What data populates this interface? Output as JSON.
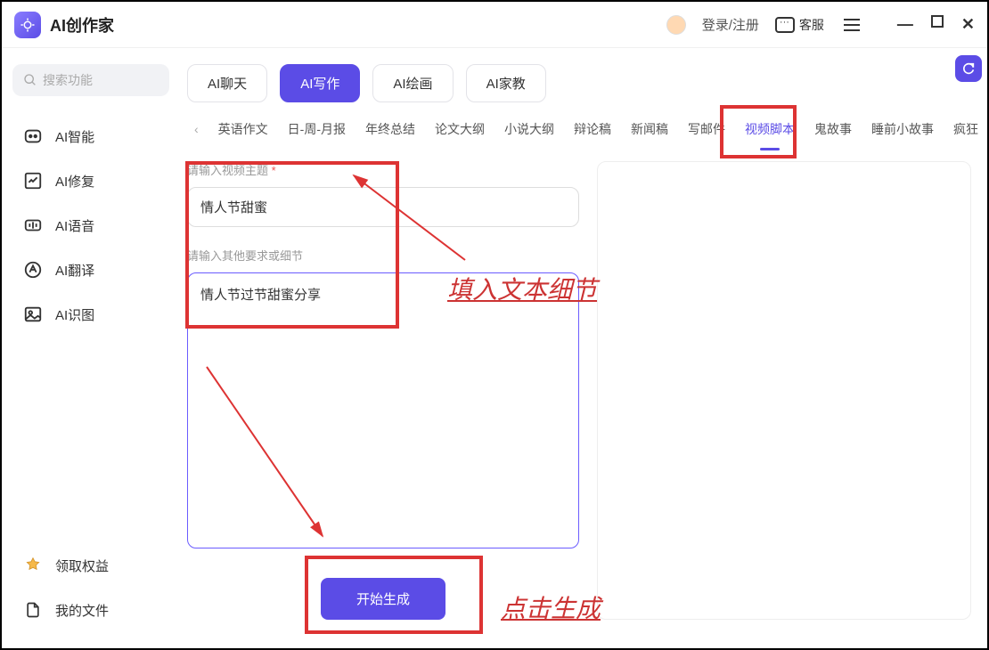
{
  "app": {
    "title": "AI创作家"
  },
  "header": {
    "login_text": "登录/注册",
    "kefu": "客服"
  },
  "sidebar": {
    "search_placeholder": "搜索功能",
    "items": [
      {
        "label": "AI智能"
      },
      {
        "label": "AI修复"
      },
      {
        "label": "AI语音"
      },
      {
        "label": "AI翻译"
      },
      {
        "label": "AI识图"
      }
    ],
    "bottom": {
      "quanyi": "领取权益",
      "wode_wenjian": "我的文件"
    }
  },
  "main_tabs": [
    {
      "label": "AI聊天",
      "active": false
    },
    {
      "label": "AI写作",
      "active": true
    },
    {
      "label": "AI绘画",
      "active": false
    },
    {
      "label": "AI家教",
      "active": false
    }
  ],
  "sub_tabs": [
    "英语作文",
    "日-周-月报",
    "年终总结",
    "论文大纲",
    "小说大纲",
    "辩论稿",
    "新闻稿",
    "写邮件",
    "视频脚本",
    "鬼故事",
    "睡前小故事",
    "疯狂"
  ],
  "sub_tab_active_index": 8,
  "form": {
    "topic_label": "请输入视频主题",
    "topic_value": "情人节甜蜜",
    "details_label": "请输入其他要求或细节",
    "details_value": "情人节过节甜蜜分享"
  },
  "buttons": {
    "generate": "开始生成"
  },
  "annotations": {
    "text1": "填入文本细节",
    "text2": "点击生成"
  }
}
